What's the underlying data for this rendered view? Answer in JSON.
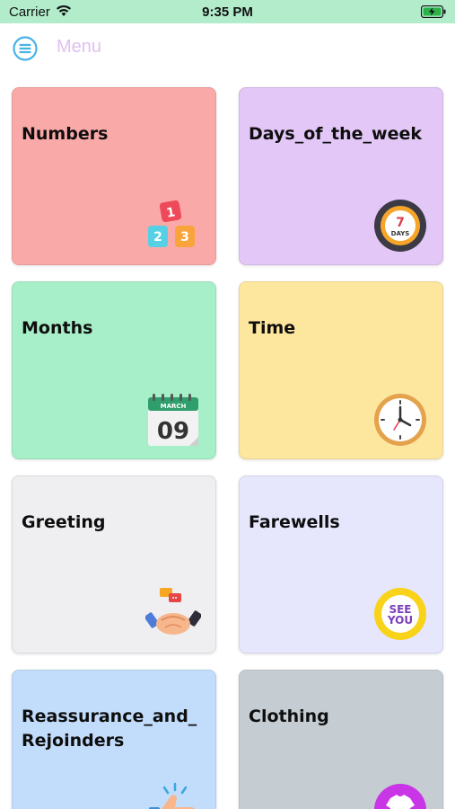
{
  "status_bar": {
    "carrier": "Carrier",
    "time": "9:35 PM",
    "background": "#b2ecca"
  },
  "nav": {
    "title": "Menu",
    "title_color": "#e1bff0",
    "menu_icon_color": "#47b3e6"
  },
  "cards": [
    {
      "label": "Numbers",
      "color": "#f9a9a8",
      "icon": "number-blocks-icon"
    },
    {
      "label": "Days_of_the_week",
      "color": "#e3c7f7",
      "icon": "seven-days-icon",
      "icon_text_top": "7",
      "icon_text_bottom": "DAYS"
    },
    {
      "label": "Months",
      "color": "#a7efc9",
      "icon": "calendar-icon",
      "icon_text_top": "MARCH",
      "icon_text_bottom": "09"
    },
    {
      "label": "Time",
      "color": "#fde79e",
      "icon": "clock-icon"
    },
    {
      "label": "Greeting",
      "color": "#efeff1",
      "icon": "handshake-icon"
    },
    {
      "label": "Farewells",
      "color": "#e6e6fd",
      "icon": "see-you-icon",
      "icon_text_top": "SEE",
      "icon_text_bottom": "YOU"
    },
    {
      "label": "Reassurance_and_\nRejoinders",
      "color": "#c2ddfb",
      "icon": "thumbs-up-icon"
    },
    {
      "label": "Clothing",
      "color": "#c5cdd3",
      "icon": "shirt-icon"
    }
  ],
  "number_blocks": [
    "1",
    "2",
    "3"
  ]
}
